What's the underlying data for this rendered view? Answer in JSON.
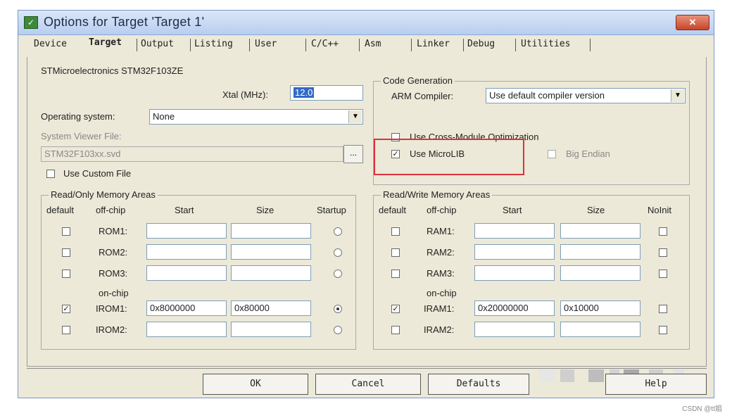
{
  "window": {
    "title": "Options for Target 'Target 1'",
    "close_label": "✕"
  },
  "tabs": [
    {
      "label": "Device"
    },
    {
      "label": "Target"
    },
    {
      "label": "Output"
    },
    {
      "label": "Listing"
    },
    {
      "label": "User"
    },
    {
      "label": "C/C++"
    },
    {
      "label": "Asm"
    },
    {
      "label": "Linker"
    },
    {
      "label": "Debug"
    },
    {
      "label": "Utilities"
    }
  ],
  "device_name": "STMicroelectronics STM32F103ZE",
  "xtal": {
    "label": "Xtal (MHz):",
    "value": "12.0"
  },
  "os": {
    "label": "Operating system:",
    "value": "None"
  },
  "svf": {
    "label": "System Viewer File:",
    "value": "STM32F103xx.svd",
    "browse": "..."
  },
  "custom_file": {
    "label": "Use Custom File",
    "checked": false
  },
  "code_gen": {
    "title": "Code Generation",
    "compiler_label": "ARM Compiler:",
    "compiler_value": "Use default compiler version",
    "cross_module": {
      "label": "Use Cross-Module Optimization",
      "checked": false
    },
    "microlib": {
      "label": "Use MicroLIB",
      "checked": true
    },
    "big_endian": {
      "label": "Big Endian",
      "checked": false
    }
  },
  "rom": {
    "title": "Read/Only Memory Areas",
    "headers": {
      "default": "default",
      "offchip": "off-chip",
      "start": "Start",
      "size": "Size",
      "last": "Startup"
    },
    "onchip_label": "on-chip",
    "rows": [
      {
        "name": "ROM1:",
        "default": false,
        "start": "",
        "size": "",
        "startup": false
      },
      {
        "name": "ROM2:",
        "default": false,
        "start": "",
        "size": "",
        "startup": false
      },
      {
        "name": "ROM3:",
        "default": false,
        "start": "",
        "size": "",
        "startup": false
      },
      {
        "name": "IROM1:",
        "default": true,
        "start": "0x8000000",
        "size": "0x80000",
        "startup": true
      },
      {
        "name": "IROM2:",
        "default": false,
        "start": "",
        "size": "",
        "startup": false
      }
    ]
  },
  "ram": {
    "title": "Read/Write Memory Areas",
    "headers": {
      "default": "default",
      "offchip": "off-chip",
      "start": "Start",
      "size": "Size",
      "last": "NoInit"
    },
    "onchip_label": "on-chip",
    "rows": [
      {
        "name": "RAM1:",
        "default": false,
        "start": "",
        "size": "",
        "noinit": false
      },
      {
        "name": "RAM2:",
        "default": false,
        "start": "",
        "size": "",
        "noinit": false
      },
      {
        "name": "RAM3:",
        "default": false,
        "start": "",
        "size": "",
        "noinit": false
      },
      {
        "name": "IRAM1:",
        "default": true,
        "start": "0x20000000",
        "size": "0x10000",
        "noinit": false
      },
      {
        "name": "IRAM2:",
        "default": false,
        "start": "",
        "size": "",
        "noinit": false
      }
    ]
  },
  "buttons": {
    "ok": "OK",
    "cancel": "Cancel",
    "defaults": "Defaults",
    "help": "Help"
  },
  "watermark": "CSDN @tt姐",
  "colors": {
    "highlight_box": "#d9333f",
    "selection": "#316ac5"
  }
}
